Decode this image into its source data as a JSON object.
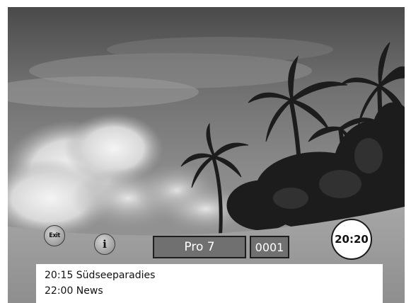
{
  "osd": {
    "exit_label": "Exit",
    "info_label": "i",
    "channel_name": "Pro 7",
    "channel_number": "0001",
    "clock": "20:20"
  },
  "epg": {
    "items": [
      {
        "time": "20:15",
        "title": "Südseeparadies",
        "text": "20:15 Südseeparadies"
      },
      {
        "time": "22:00",
        "title": "News",
        "text": "22:00 News"
      }
    ]
  },
  "icons": {
    "exit": "exit-icon",
    "info": "info-icon",
    "clock": "clock-icon"
  },
  "colors": {
    "osd_box": "#707070",
    "osd_text": "#ffffff",
    "panel": "#ffffff"
  }
}
